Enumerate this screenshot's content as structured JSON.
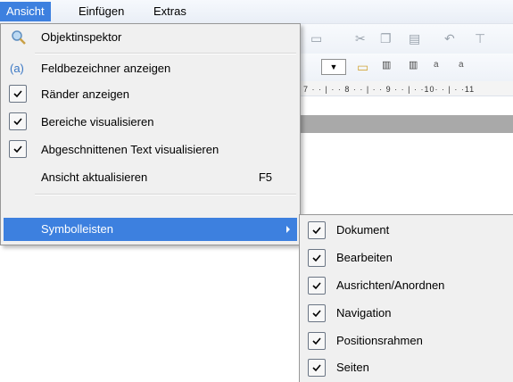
{
  "menubar": {
    "items": [
      {
        "label": "Ansicht"
      },
      {
        "label": "Einfügen"
      },
      {
        "label": "Extras"
      }
    ]
  },
  "menu": {
    "objektinspektor": "Objektinspektor",
    "feldbezeichner": "Feldbezeichner anzeigen",
    "raender": "Ränder anzeigen",
    "bereiche": "Bereiche visualisieren",
    "abgeschnitten": "Abgeschnittenen Text visualisieren",
    "aktualisieren": "Ansicht aktualisieren",
    "aktualisieren_shortcut": "F5",
    "symbolleisten": "Symbolleisten"
  },
  "submenu": {
    "items": [
      {
        "label": "Dokument",
        "checked": true
      },
      {
        "label": "Bearbeiten",
        "checked": true
      },
      {
        "label": "Ausrichten/Anordnen",
        "checked": true
      },
      {
        "label": "Navigation",
        "checked": true
      },
      {
        "label": "Positionsrahmen",
        "checked": true
      },
      {
        "label": "Seiten",
        "checked": true
      }
    ]
  },
  "background": {
    "ruler": "7 · · | · · 8 · · | · · 9 · · | · ·10· · | · ·11"
  },
  "colors": {
    "highlight": "#3d80df",
    "menu_bg": "#f0f0f0"
  }
}
